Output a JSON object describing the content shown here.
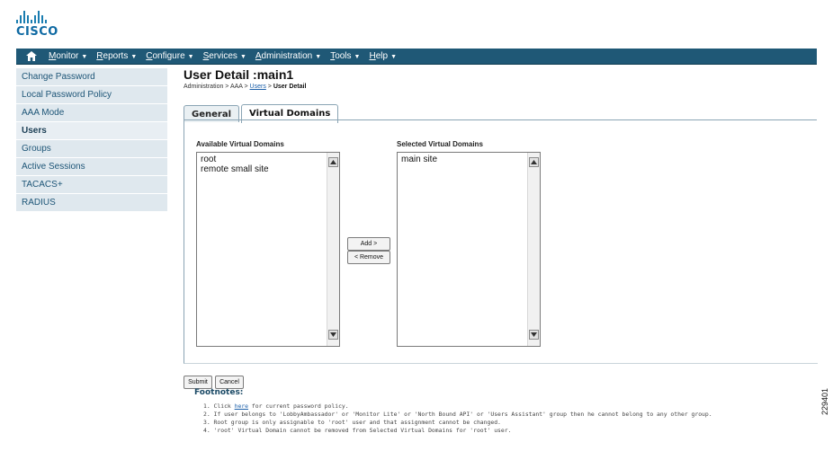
{
  "brand": {
    "logo_text": "CISCO"
  },
  "nav": {
    "items": [
      {
        "first": "M",
        "rest": "onitor"
      },
      {
        "first": "R",
        "rest": "eports"
      },
      {
        "first": "C",
        "rest": "onfigure"
      },
      {
        "first": "S",
        "rest": "ervices"
      },
      {
        "first": "A",
        "rest": "dministration"
      },
      {
        "first": "T",
        "rest": "ools"
      },
      {
        "first": "H",
        "rest": "elp"
      }
    ]
  },
  "sidebar": {
    "items": [
      {
        "label": "Change Password"
      },
      {
        "label": "Local Password Policy"
      },
      {
        "label": "AAA Mode"
      },
      {
        "label": "Users"
      },
      {
        "label": "Groups"
      },
      {
        "label": "Active Sessions"
      },
      {
        "label": "TACACS+"
      },
      {
        "label": "RADIUS"
      }
    ],
    "active_index": 3
  },
  "page": {
    "title": "User Detail :main1",
    "breadcrumb": {
      "part1": "Administration > AAA > ",
      "link": "Users",
      "sep": " > ",
      "current": "User Detail"
    }
  },
  "tabs": [
    {
      "label": "General"
    },
    {
      "label": "Virtual Domains"
    }
  ],
  "domains": {
    "available_label": "Available Virtual Domains",
    "available": [
      "root",
      "remote small site"
    ],
    "selected_label": "Selected Virtual Domains",
    "selected": [
      "main site"
    ],
    "add_button": "Add >",
    "remove_button": "< Remove"
  },
  "actions": {
    "submit": "Submit",
    "cancel": "Cancel"
  },
  "footnotes": {
    "title": "Footnotes:",
    "note1_pre": "1. Click ",
    "note1_link": "here",
    "note1_post": " for current password policy.",
    "note2": "2. If user belongs to 'LobbyAmbassador' or 'Monitor Lite' or 'North Bound API' or 'Users Assistant' group then he cannot belong to any other group.",
    "note3": "3. Root group is only assignable to 'root' user and that assignment cannot be changed.",
    "note4": "4. 'root' Virtual Domain cannot be removed from Selected Virtual Domains for 'root' user."
  },
  "figure_id": "229401",
  "colors": {
    "nav_bg": "#1f5876",
    "sidebar_bg": "#dfe8ee",
    "link": "#1a5ea8",
    "brand": "#0f6aa3"
  }
}
